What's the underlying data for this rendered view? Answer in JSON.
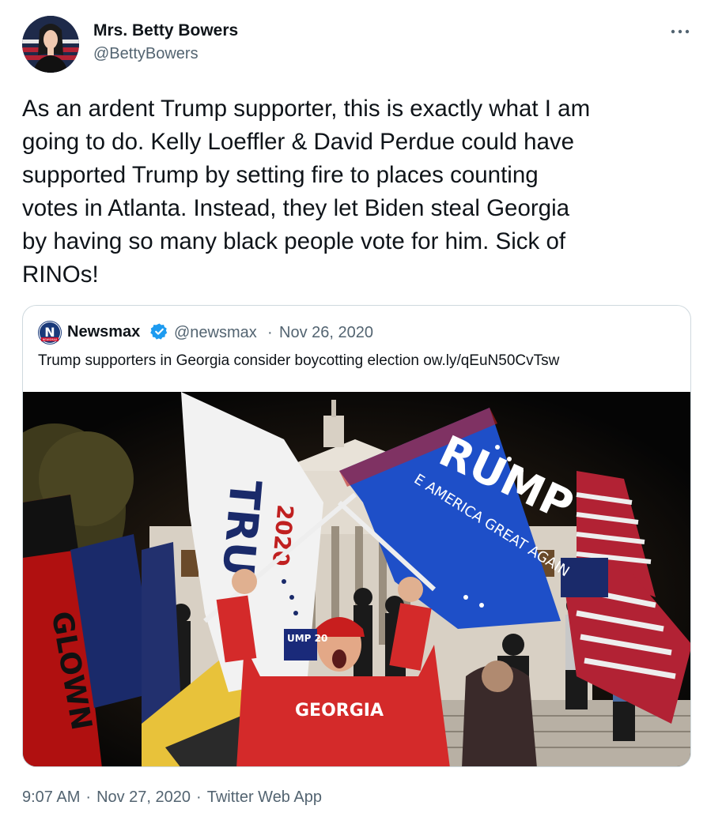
{
  "tweet": {
    "author_name": "Mrs. Betty Bowers",
    "author_handle": "@BettyBowers",
    "text": "As an ardent Trump supporter, this is exactly what I am\ngoing to do. Kelly Loeffler & David Perdue could have\nsupported Trump by setting fire to places counting\nvotes in Atlanta. Instead, they let Biden steal Georgia\nby having so many black people vote for him. Sick of\nRINOs!",
    "more_icon": "more-horizontal-icon",
    "time": "9:07 AM",
    "date": "Nov 27, 2020",
    "source": "Twitter Web App",
    "separator": "·"
  },
  "quoted_tweet": {
    "logo_letter": "N",
    "logo_caption": "NEWSMAX",
    "name": "Newsmax",
    "verified_icon": "verified-badge-icon",
    "handle": "@newsmax",
    "separator": "·",
    "date": "Nov 26, 2020",
    "text": "Trump supporters in Georgia consider boycotting election ow.ly/qEuN50CvTsw",
    "photo": {
      "description": "Night rally in front of Georgia State Capitol with waving Trump flags",
      "blue_flag_text": "RUMP",
      "blue_flag_slogan": "E AMERICA GREAT AGAIN",
      "white_flag_text": "TRU",
      "white_flag_year": "2020",
      "left_flag_text": "GLOWN",
      "shirt_text": "GEORGIA",
      "sign_text": "UMP 20"
    }
  },
  "colors": {
    "text": "#0f1419",
    "secondary": "#536471",
    "border": "#cfd9de",
    "verified": "#1d9bf0",
    "newsmax": "#1a3a7a"
  }
}
